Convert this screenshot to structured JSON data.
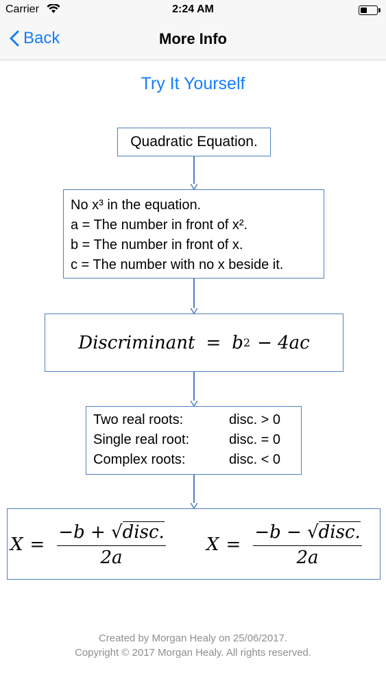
{
  "status": {
    "carrier": "Carrier",
    "time": "2:24 AM"
  },
  "nav": {
    "back_label": "Back",
    "title": "More Info"
  },
  "main": {
    "try_link": "Try It Yourself",
    "box1": "Quadratic Equation.",
    "box2_lines": [
      "No x³ in the equation.",
      "a = The number in front of x².",
      "b = The number in front of x.",
      "c = The number with no x beside it."
    ],
    "discriminant": {
      "label": "Discriminant",
      "eq": "=",
      "b": "b",
      "exp": "2",
      "rest": "− 4ac"
    },
    "roots": [
      {
        "label": "Two real roots:",
        "cond": "disc. > 0"
      },
      {
        "label": "Single real root:",
        "cond": "disc. = 0"
      },
      {
        "label": "Complex roots:",
        "cond": "disc. < 0"
      }
    ],
    "formula": {
      "x": "X",
      "eq": "=",
      "num1_prefix": "−b +",
      "num2_prefix": "−b −",
      "radicand": "disc.",
      "den": "2a"
    }
  },
  "footer": {
    "line1": "Created by Morgan Healy on 25/06/2017.",
    "line2": "Copyright © 2017 Morgan Healy. All rights reserved."
  },
  "colors": {
    "accent": "#147efb",
    "box_border": "#4f7fbf",
    "footer_text": "#8e8e8e"
  }
}
